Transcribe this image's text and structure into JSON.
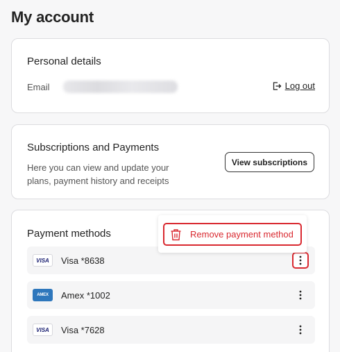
{
  "page": {
    "title": "My account"
  },
  "personal": {
    "title": "Personal details",
    "email_label": "Email",
    "logout_label": "Log out"
  },
  "subscriptions": {
    "title": "Subscriptions and Payments",
    "description": "Here you can view and update your plans, payment history and receipts",
    "button_label": "View subscriptions"
  },
  "payment": {
    "title": "Payment methods",
    "methods": [
      {
        "logo": "VISA",
        "label": "Visa *8638"
      },
      {
        "logo": "AMEX",
        "label": "Amex *1002"
      },
      {
        "logo": "VISA",
        "label": "Visa *7628"
      }
    ],
    "menu": {
      "remove_label": "Remove payment method"
    }
  },
  "colors": {
    "danger": "#d9282f",
    "visa_blue": "#1a1f71",
    "amex_blue": "#2e77bc"
  },
  "icons": [
    "logout-icon",
    "trash-icon",
    "kebab-icon",
    "visa-logo",
    "amex-logo"
  ]
}
